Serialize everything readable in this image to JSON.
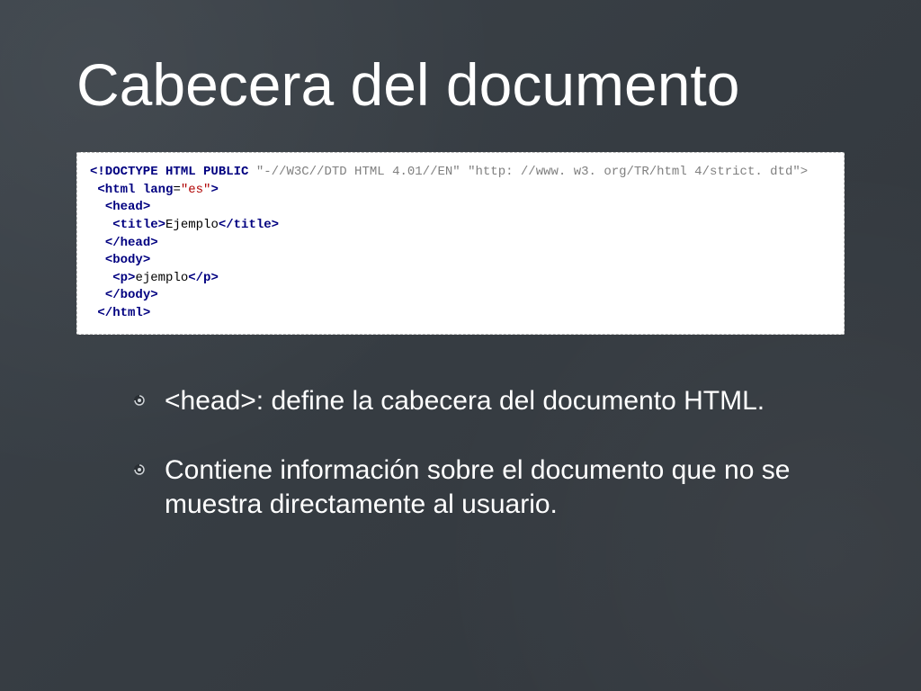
{
  "title": "Cabecera del documento",
  "code": {
    "line1_doctype": "<!DOCTYPE HTML PUBLIC",
    "line1_fpi": "\"-//W3C//DTD HTML 4.01//EN\"",
    "line1_uri": "\"http: //www. w3. org/TR/html 4/strict. dtd\">",
    "line2_open": "<html",
    "line2_attr": " lang",
    "line2_eq": "=",
    "line2_val": "\"es\"",
    "line2_close": ">",
    "line3": "<head>",
    "line4_open": "<title>",
    "line4_text": "Ejemplo",
    "line4_close": "</title>",
    "line5": "</head>",
    "line6": "<body>",
    "line7_open": "<p>",
    "line7_text": "ejemplo",
    "line7_close": "</p>",
    "line8": "</body>",
    "line9": "</html>"
  },
  "bullets": [
    "<head>: define la cabecera del documento HTML.",
    "Contiene información sobre el documento que no se muestra directamente al usuario."
  ]
}
